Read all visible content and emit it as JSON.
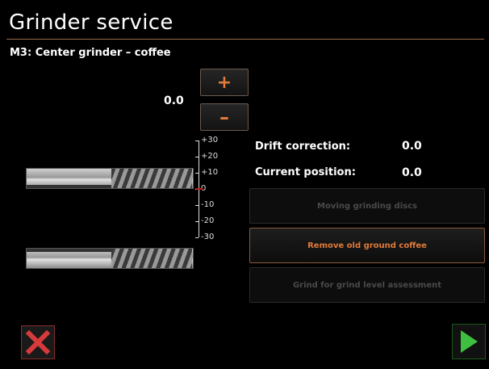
{
  "header": {
    "title": "Grinder service",
    "subtitle": "M3: Center grinder – coffee"
  },
  "adjust": {
    "value": "0.0",
    "plus_label": "+",
    "minus_label": "–"
  },
  "scale": {
    "ticks": [
      "+30",
      "+20",
      "+10",
      "0",
      "-10",
      "-20",
      "-30"
    ],
    "marker": "0"
  },
  "info": {
    "drift_label": "Drift correction:",
    "drift_value": "0.0",
    "position_label": "Current position:",
    "position_value": "0.0"
  },
  "actions": [
    {
      "label": "Moving grinding discs",
      "enabled": false
    },
    {
      "label": "Remove old ground coffee",
      "enabled": true
    },
    {
      "label": "Grind for grind level assessment",
      "enabled": false
    }
  ],
  "footer": {
    "cancel_icon": "x-icon",
    "next_icon": "play-icon"
  },
  "colors": {
    "accent": "#e07a3a",
    "cancel": "#d63a3a",
    "next": "#3fbf3f",
    "zero_marker": "#d01818"
  }
}
